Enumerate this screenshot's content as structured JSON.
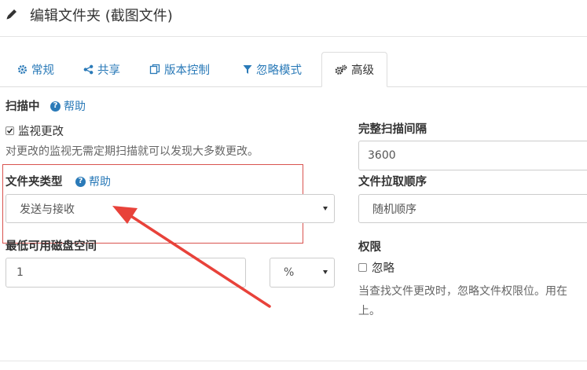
{
  "header": {
    "title": "编辑文件夹 (截图文件)",
    "icon": "pencil-icon"
  },
  "tabs": [
    {
      "label": "常规",
      "icon": "gear-icon",
      "active": false
    },
    {
      "label": "共享",
      "icon": "share-icon",
      "active": false
    },
    {
      "label": "版本控制",
      "icon": "copy-icon",
      "active": false
    },
    {
      "label": "忽略模式",
      "icon": "filter-icon",
      "active": false
    },
    {
      "label": "高级",
      "icon": "gears-icon",
      "active": true
    }
  ],
  "left": {
    "scanning_label": "扫描中",
    "help_label": "帮助",
    "watch_checkbox_label": "监视更改",
    "watch_checked": true,
    "watch_help_text": "对更改的监视无需定期扫描就可以发现大多数更改。",
    "folder_type_label": "文件夹类型",
    "folder_type_help": "帮助",
    "folder_type_value": "发送与接收",
    "min_disk_label": "最低可用磁盘空间",
    "min_disk_value": "1",
    "min_disk_unit": "%"
  },
  "right": {
    "full_scan_label": "完整扫描间隔",
    "full_scan_value": "3600",
    "pull_order_label": "文件拉取顺序",
    "pull_order_value": "随机顺序",
    "permissions_label": "权限",
    "ignore_checkbox_label": "忽略",
    "ignore_checked": false,
    "permissions_help_line1": "当查找文件更改时，忽略文件权限位。用在",
    "permissions_help_line2": "上。"
  },
  "annotation": {
    "box_color": "#d9534f",
    "arrow_color": "#e8423a"
  },
  "colors": {
    "link": "#2a7ab8",
    "text": "#333333",
    "border": "#cccccc"
  }
}
